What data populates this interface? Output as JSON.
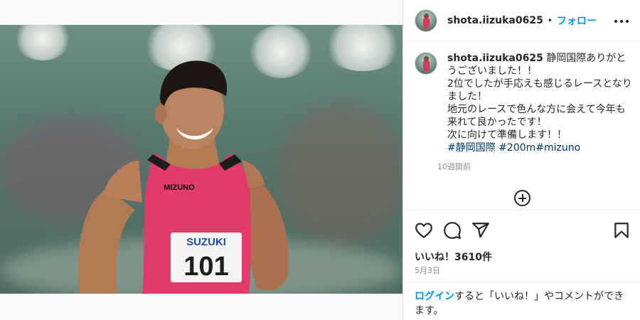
{
  "post": {
    "image_alt": "Sprinter in pink Mizuno racing singlet with SUZUKI bib 101 smiling on a track",
    "bib": {
      "sponsor": "SUZUKI",
      "number": "101"
    },
    "singlet_brand": "MIZUNO"
  },
  "header": {
    "username": "shota.iizuka0625",
    "separator": "•",
    "follow_label": "フォロー"
  },
  "caption": {
    "username": "shota.iizuka0625",
    "text": "静岡国際ありがとうございました！！\n2位でしたが手応えも感じるレースとなりました！\n地元のレースで色んな方に会えて今年も来れて良かったです！\n次に向けて準備します！！\n",
    "hashtags": [
      "#静岡国際",
      " #200m",
      "#mizuno"
    ],
    "timestamp": "10週間前"
  },
  "actions": {
    "icons": [
      "heart-icon",
      "comment-icon",
      "share-icon",
      "bookmark-icon"
    ],
    "likes": "いいね！3610件",
    "date": "5月3日"
  },
  "footer": {
    "login_label": "ログイン",
    "rest": "すると「いいね！」やコメントができます。"
  },
  "colors": {
    "link": "#0095f6",
    "hashtag": "#00376b",
    "singlet": "#e23b6a"
  }
}
